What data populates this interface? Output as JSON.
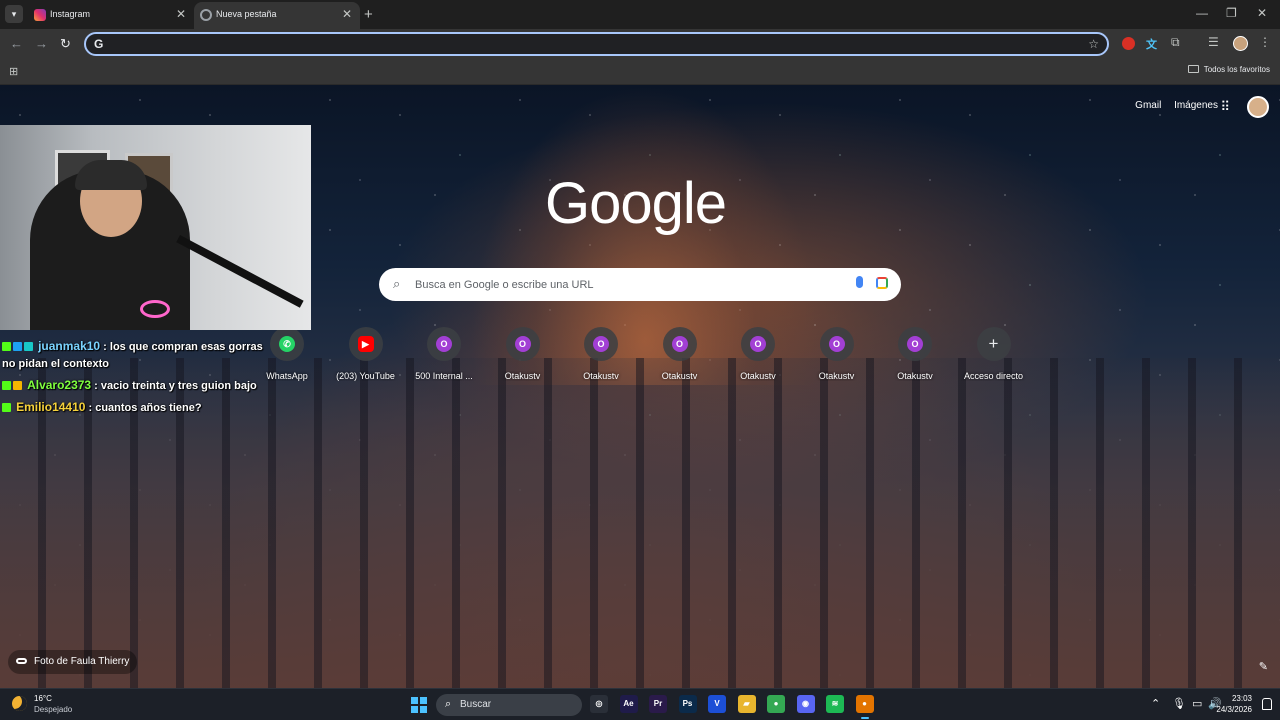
{
  "browser": {
    "tabs": [
      {
        "title": "Instagram",
        "icon": "instagram-icon",
        "active": false
      },
      {
        "title": "Nueva pestaña",
        "icon": "chrome-icon",
        "active": true
      }
    ],
    "omnibox": {
      "value": "",
      "placeholder": ""
    },
    "bookmarks": {
      "all_bookmarks_label": "Todos los favoritos"
    }
  },
  "ntp": {
    "header_links": {
      "gmail": "Gmail",
      "images": "Imágenes"
    },
    "logo_text": "Google",
    "search": {
      "placeholder": "Busca en Google o escribe una URL"
    },
    "shortcuts": [
      {
        "label": "WhatsApp",
        "icon": "whatsapp-icon",
        "glyph": "✆",
        "style": "wa"
      },
      {
        "label": "(203) YouTube",
        "icon": "youtube-icon",
        "glyph": "▶",
        "style": "yt"
      },
      {
        "label": "500 Internal ...",
        "icon": "otakustv-icon",
        "glyph": "O",
        "style": "ot"
      },
      {
        "label": "Otakustv",
        "icon": "otakustv-icon",
        "glyph": "O",
        "style": "ot"
      },
      {
        "label": "Otakustv",
        "icon": "otakustv-icon",
        "glyph": "O",
        "style": "ot"
      },
      {
        "label": "Otakustv",
        "icon": "otakustv-icon",
        "glyph": "O",
        "style": "ot"
      },
      {
        "label": "Otakustv",
        "icon": "otakustv-icon",
        "glyph": "O",
        "style": "ot"
      },
      {
        "label": "Otakustv",
        "icon": "otakustv-icon",
        "glyph": "O",
        "style": "ot"
      },
      {
        "label": "Otakustv",
        "icon": "otakustv-icon",
        "glyph": "O",
        "style": "ot"
      },
      {
        "label": "Acceso directo",
        "icon": "add-shortcut-icon",
        "glyph": "+",
        "style": "plus"
      }
    ],
    "photo_credit": "Foto de Faula Thierry"
  },
  "stream_chat": {
    "messages": [
      {
        "user": "juanmak10",
        "text": " : los que compran esas gorras",
        "cont": "no pidan el contexto"
      },
      {
        "user": "Alvaro2373",
        "text": " : vacio treinta y tres guion bajo",
        "cont": ""
      },
      {
        "user": "Emilio14410",
        "text": " : cuantos años tiene?",
        "cont": ""
      }
    ]
  },
  "taskbar": {
    "weather": {
      "temp": "16°C",
      "desc": "Despejado"
    },
    "search_label": "Buscar",
    "apps": [
      {
        "name": "steam-app-icon",
        "glyph": "◎",
        "color": "#2a2f38"
      },
      {
        "name": "after-effects-app-icon",
        "glyph": "Ae",
        "color": "#1f1b4a"
      },
      {
        "name": "premiere-app-icon",
        "glyph": "Pr",
        "color": "#2a1a4a"
      },
      {
        "name": "photoshop-app-icon",
        "glyph": "Ps",
        "color": "#0b2a4a"
      },
      {
        "name": "vegas-app-icon",
        "glyph": "V",
        "color": "#1c4fd6"
      },
      {
        "name": "file-explorer-app-icon",
        "glyph": "▰",
        "color": "#e8b52e"
      },
      {
        "name": "chrome-app-icon",
        "glyph": "●",
        "color": "#34a853"
      },
      {
        "name": "discord-app-icon",
        "glyph": "◉",
        "color": "#5865f2"
      },
      {
        "name": "spotify-app-icon",
        "glyph": "≋",
        "color": "#1db954"
      },
      {
        "name": "chrome-canary-app-icon",
        "glyph": "●",
        "color": "#e37400"
      }
    ],
    "clock": {
      "time": "23:03",
      "date": "24/3/2026"
    }
  }
}
